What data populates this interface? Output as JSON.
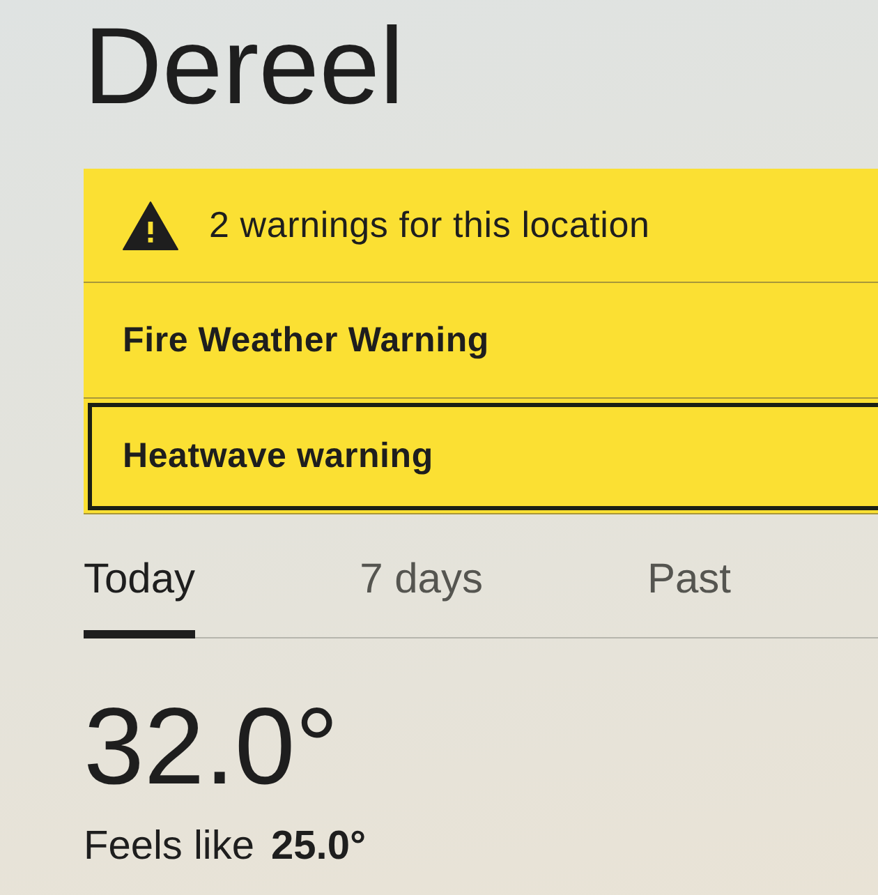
{
  "location": {
    "title": "Dereel"
  },
  "warnings": {
    "summary": "2 warnings for this location",
    "items": [
      {
        "title": "Fire Weather Warning",
        "focused": false
      },
      {
        "title": "Heatwave warning",
        "focused": true
      }
    ]
  },
  "tabs": [
    {
      "label": "Today",
      "selected": true
    },
    {
      "label": "7 days",
      "selected": false
    },
    {
      "label": "Past",
      "selected": false
    }
  ],
  "current": {
    "temperature": "32.0°",
    "feels_like_label": "Feels like",
    "feels_like": "25.0°"
  }
}
